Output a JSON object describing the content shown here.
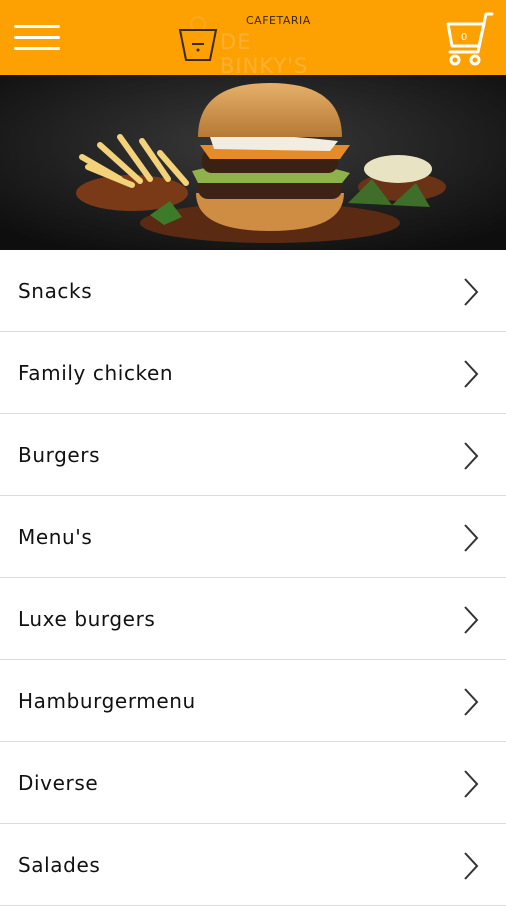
{
  "header": {
    "logo_top": "CAFETARIA",
    "logo_bottom": "DE BINKY'S",
    "cart_count": "0",
    "brand_color": "#fca101",
    "menu_icon": "hamburger-menu-icon",
    "cart_icon": "shopping-cart-icon"
  },
  "categories": [
    {
      "label": "Snacks"
    },
    {
      "label": "Family chicken"
    },
    {
      "label": "Burgers"
    },
    {
      "label": "Menu's"
    },
    {
      "label": "Luxe burgers"
    },
    {
      "label": "Hamburgermenu"
    },
    {
      "label": "Diverse"
    },
    {
      "label": "Salades"
    }
  ]
}
